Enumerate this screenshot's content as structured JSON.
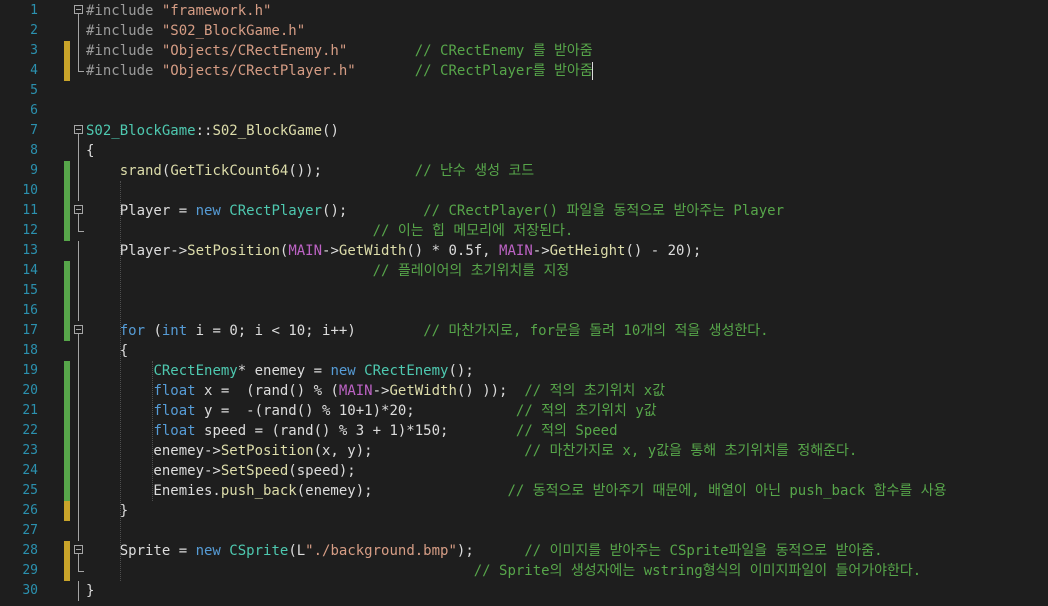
{
  "editor": {
    "theme_colors": {
      "background": "#1e1e1e",
      "line_number": "#2b91af",
      "keyword": "#569cd6",
      "type": "#4ec9b0",
      "string": "#d69d85",
      "comment": "#57a64a",
      "macro": "#bd63c5",
      "function": "#dcdcaa",
      "change_saved": "#57a64a",
      "change_unsaved": "#c9a42a"
    },
    "lines": [
      {
        "n": "1",
        "change": "none",
        "fold": "box",
        "tokens": [
          [
            "pp",
            "#include "
          ],
          [
            "str",
            "\"framework.h\""
          ]
        ]
      },
      {
        "n": "2",
        "change": "none",
        "fold": "line",
        "tokens": [
          [
            "pp",
            "#include "
          ],
          [
            "str",
            "\"S02_BlockGame.h\""
          ]
        ]
      },
      {
        "n": "3",
        "change": "unsaved",
        "fold": "line",
        "tokens": [
          [
            "pp",
            "#include "
          ],
          [
            "str",
            "\"Objects/CRectEnemy.h\""
          ],
          [
            "pl",
            "        "
          ],
          [
            "cm",
            "// CRectEnemy 를 받아줌"
          ]
        ]
      },
      {
        "n": "4",
        "change": "unsaved",
        "fold": "end",
        "tokens": [
          [
            "pp",
            "#include "
          ],
          [
            "str",
            "\"Objects/CRectPlayer.h\""
          ],
          [
            "pl",
            "       "
          ],
          [
            "cm",
            "// CRectPlayer를 받아줌"
          ]
        ]
      },
      {
        "n": "5",
        "change": "none",
        "fold": "none",
        "tokens": []
      },
      {
        "n": "6",
        "change": "none",
        "fold": "none",
        "tokens": []
      },
      {
        "n": "7",
        "change": "none",
        "fold": "box",
        "tokens": [
          [
            "type",
            "S02_BlockGame"
          ],
          [
            "pl",
            "::"
          ],
          [
            "func",
            "S02_BlockGame"
          ],
          [
            "pl",
            "()"
          ]
        ]
      },
      {
        "n": "8",
        "change": "none",
        "fold": "line",
        "tokens": [
          [
            "pl",
            "{"
          ]
        ]
      },
      {
        "n": "9",
        "change": "saved",
        "fold": "line",
        "tokens": [
          [
            "pl",
            "    "
          ],
          [
            "func",
            "srand"
          ],
          [
            "pl",
            "("
          ],
          [
            "func",
            "GetTickCount64"
          ],
          [
            "pl",
            "());"
          ],
          [
            "pl",
            "           "
          ],
          [
            "cm",
            "// 난수 생성 코드"
          ]
        ]
      },
      {
        "n": "10",
        "change": "saved",
        "fold": "line",
        "tokens": []
      },
      {
        "n": "11",
        "change": "saved",
        "fold": "box",
        "tokens": [
          [
            "pl",
            "    Player = "
          ],
          [
            "kw",
            "new "
          ],
          [
            "type",
            "CRectPlayer"
          ],
          [
            "pl",
            "();"
          ],
          [
            "pl",
            "         "
          ],
          [
            "cm",
            "// CRectPlayer() 파일을 동적으로 받아주는 Player"
          ]
        ]
      },
      {
        "n": "12",
        "change": "saved",
        "fold": "end",
        "tokens": [
          [
            "pl",
            "                                  "
          ],
          [
            "cm",
            "// 이는 힙 메모리에 저장된다."
          ]
        ]
      },
      {
        "n": "13",
        "change": "none",
        "fold": "line",
        "tokens": [
          [
            "pl",
            "    Player->"
          ],
          [
            "func",
            "SetPosition"
          ],
          [
            "pl",
            "("
          ],
          [
            "macro",
            "MAIN"
          ],
          [
            "pl",
            "->"
          ],
          [
            "func",
            "GetWidth"
          ],
          [
            "pl",
            "() * 0.5f, "
          ],
          [
            "macro",
            "MAIN"
          ],
          [
            "pl",
            "->"
          ],
          [
            "func",
            "GetHeight"
          ],
          [
            "pl",
            "() - 20);"
          ]
        ]
      },
      {
        "n": "14",
        "change": "saved",
        "fold": "line",
        "tokens": [
          [
            "pl",
            "                                  "
          ],
          [
            "cm",
            "// 플레이어의 초기위치를 지정"
          ]
        ]
      },
      {
        "n": "15",
        "change": "saved",
        "fold": "line",
        "tokens": []
      },
      {
        "n": "16",
        "change": "saved",
        "fold": "line",
        "tokens": []
      },
      {
        "n": "17",
        "change": "saved",
        "fold": "box",
        "tokens": [
          [
            "pl",
            "    "
          ],
          [
            "kw",
            "for"
          ],
          [
            "pl",
            " ("
          ],
          [
            "kw",
            "int"
          ],
          [
            "pl",
            " i = 0; i < 10; i++)"
          ],
          [
            "pl",
            "        "
          ],
          [
            "cm",
            "// 마찬가지로, for문을 돌려 10개의 적을 생성한다."
          ]
        ]
      },
      {
        "n": "18",
        "change": "none",
        "fold": "line",
        "tokens": [
          [
            "pl",
            "    {"
          ]
        ]
      },
      {
        "n": "19",
        "change": "saved",
        "fold": "line",
        "tokens": [
          [
            "pl",
            "        "
          ],
          [
            "type",
            "CRectEnemy"
          ],
          [
            "pl",
            "* enemey = "
          ],
          [
            "kw",
            "new "
          ],
          [
            "type",
            "CRectEnemy"
          ],
          [
            "pl",
            "();"
          ]
        ]
      },
      {
        "n": "20",
        "change": "saved",
        "fold": "line",
        "tokens": [
          [
            "pl",
            "        "
          ],
          [
            "kw",
            "float"
          ],
          [
            "pl",
            " x =  (rand() % ("
          ],
          [
            "macro",
            "MAIN"
          ],
          [
            "pl",
            "->"
          ],
          [
            "func",
            "GetWidth"
          ],
          [
            "pl",
            "() ));  "
          ],
          [
            "cm",
            "// 적의 초기위치 x값"
          ]
        ]
      },
      {
        "n": "21",
        "change": "saved",
        "fold": "line",
        "tokens": [
          [
            "pl",
            "        "
          ],
          [
            "kw",
            "float"
          ],
          [
            "pl",
            " y =  -(rand() % 10+1)*20;            "
          ],
          [
            "cm",
            "// 적의 초기위치 y값"
          ]
        ]
      },
      {
        "n": "22",
        "change": "saved",
        "fold": "line",
        "tokens": [
          [
            "pl",
            "        "
          ],
          [
            "kw",
            "float"
          ],
          [
            "pl",
            " speed = (rand() % 3 + 1)*150;        "
          ],
          [
            "cm",
            "// 적의 Speed"
          ]
        ]
      },
      {
        "n": "23",
        "change": "saved",
        "fold": "line",
        "tokens": [
          [
            "pl",
            "        enemey->"
          ],
          [
            "func",
            "SetPosition"
          ],
          [
            "pl",
            "(x, y);                  "
          ],
          [
            "cm",
            "// 마찬가지로 x, y값을 통해 초기위치를 정해준다."
          ]
        ]
      },
      {
        "n": "24",
        "change": "saved",
        "fold": "line",
        "tokens": [
          [
            "pl",
            "        enemey->"
          ],
          [
            "func",
            "SetSpeed"
          ],
          [
            "pl",
            "(speed);"
          ]
        ]
      },
      {
        "n": "25",
        "change": "saved",
        "fold": "line",
        "tokens": [
          [
            "pl",
            "        Enemies."
          ],
          [
            "func",
            "push_back"
          ],
          [
            "pl",
            "(enemey);                "
          ],
          [
            "cm",
            "// 동적으로 받아주기 때문에, 배열이 아닌 push_back 함수를 사용"
          ]
        ]
      },
      {
        "n": "26",
        "change": "unsaved",
        "fold": "line",
        "tokens": [
          [
            "pl",
            "    }"
          ]
        ]
      },
      {
        "n": "27",
        "change": "none",
        "fold": "line",
        "tokens": []
      },
      {
        "n": "28",
        "change": "unsaved",
        "fold": "box",
        "tokens": [
          [
            "pl",
            "    Sprite = "
          ],
          [
            "kw",
            "new "
          ],
          [
            "type",
            "CSprite"
          ],
          [
            "pl",
            "(L"
          ],
          [
            "str",
            "\"./background.bmp\""
          ],
          [
            "pl",
            ");      "
          ],
          [
            "cm",
            "// 이미지를 받아주는 CSprite파일을 동적으로 받아줌."
          ]
        ]
      },
      {
        "n": "29",
        "change": "unsaved",
        "fold": "end",
        "tokens": [
          [
            "pl",
            "                                              "
          ],
          [
            "cm",
            "// Sprite의 생성자에는 wstring형식의 이미지파일이 들어가야한다."
          ]
        ]
      },
      {
        "n": "30",
        "change": "none",
        "fold": "line",
        "tokens": [
          [
            "pl",
            "}"
          ]
        ]
      }
    ]
  }
}
